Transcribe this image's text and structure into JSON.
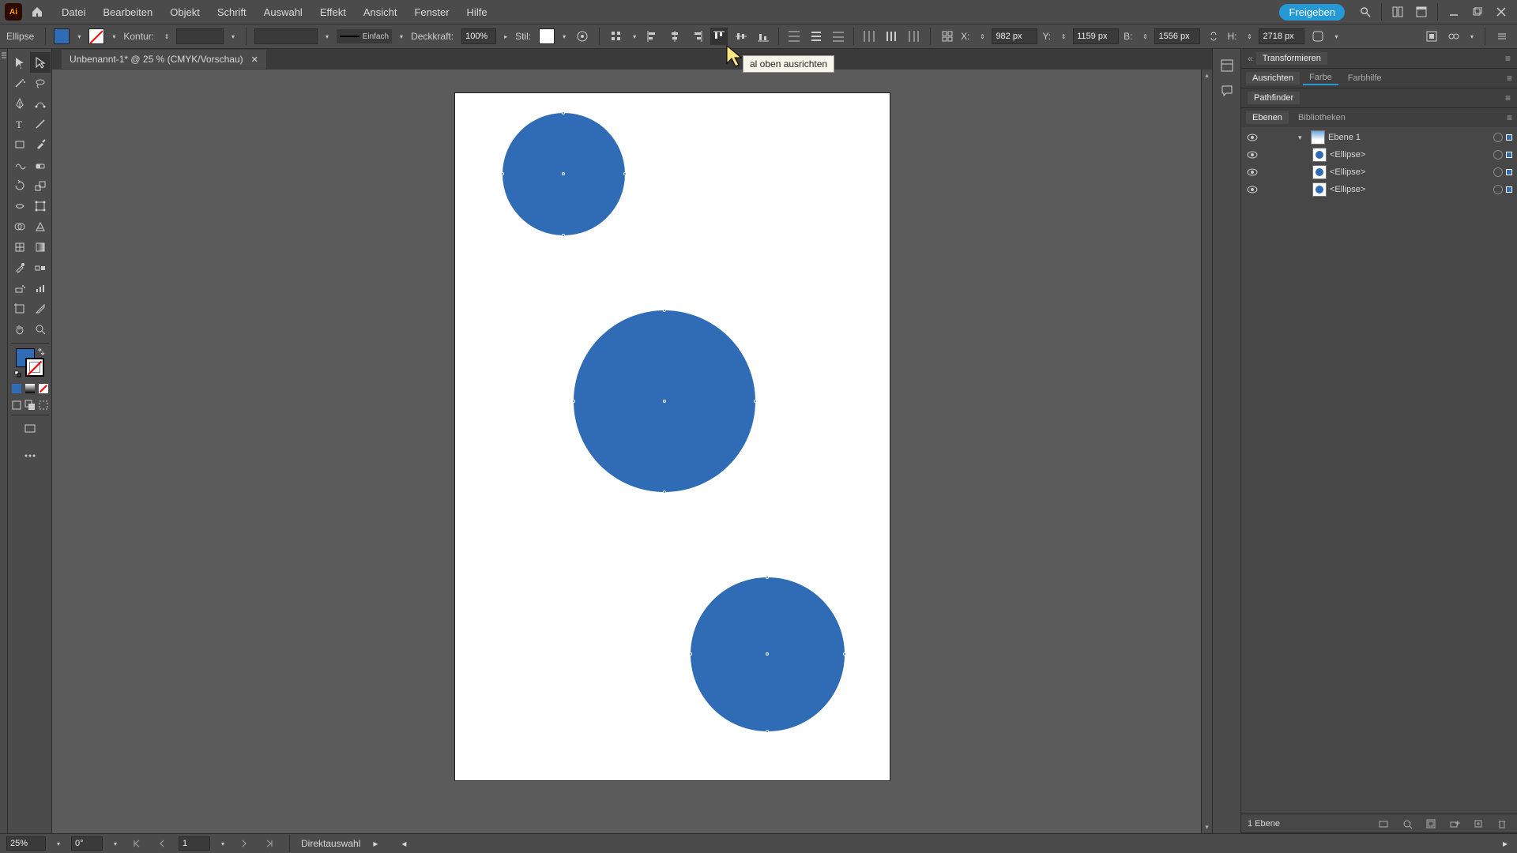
{
  "app": {
    "logo": "Ai",
    "menus": [
      "Datei",
      "Bearbeiten",
      "Objekt",
      "Schrift",
      "Auswahl",
      "Effekt",
      "Ansicht",
      "Fenster",
      "Hilfe"
    ],
    "share": "Freigeben"
  },
  "options": {
    "object_type": "Ellipse",
    "stroke_label": "Kontur:",
    "stroke_weight": "",
    "stroke_style": "Einfach",
    "opacity_label": "Deckkraft:",
    "opacity_value": "100%",
    "style_label": "Stil:",
    "x_label": "X:",
    "x_value": "982 px",
    "y_label": "Y:",
    "y_value": "1159 px",
    "w_label": "B:",
    "w_value": "1556 px",
    "h_label": "H:",
    "h_value": "2718 px"
  },
  "tooltip": "al oben ausrichten",
  "doc": {
    "tab": "Unbenannt-1* @ 25 % (CMYK/Vorschau)"
  },
  "status": {
    "zoom": "25%",
    "rotation": "0°",
    "artboard": "1",
    "tool": "Direktauswahl",
    "layer_count": "1 Ebene"
  },
  "panels": {
    "transform_tab": "Transformieren",
    "align_tab": "Ausrichten",
    "color_tab": "Farbe",
    "guide_tab": "Farbhilfe",
    "pathfinder": "Pathfinder",
    "layers_tab": "Ebenen",
    "libraries_tab": "Bibliotheken",
    "layer_items": [
      "Ebene 1",
      "<Ellipse>",
      "<Ellipse>",
      "<Ellipse>"
    ]
  },
  "colors": {
    "fill": "#2f6cb5",
    "accent": "#2598d6"
  }
}
